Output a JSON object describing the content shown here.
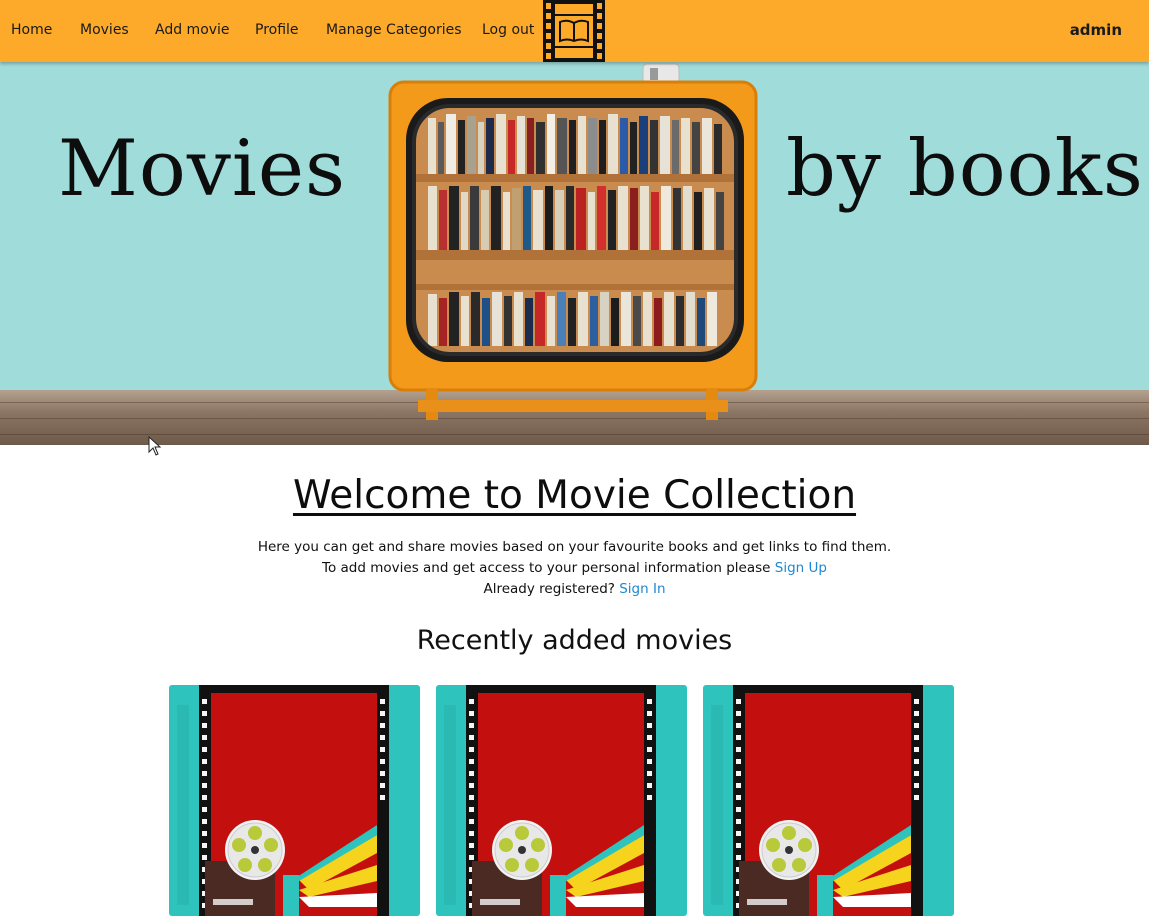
{
  "nav": {
    "items": [
      {
        "label": "Home"
      },
      {
        "label": "Movies"
      },
      {
        "label": "Add movie"
      },
      {
        "label": "Profile"
      },
      {
        "label": "Manage Categories"
      },
      {
        "label": "Log out"
      }
    ],
    "user": "admin"
  },
  "hero": {
    "left_text": "Movies",
    "right_text": "by books"
  },
  "content": {
    "title": "Welcome to Movie Collection",
    "line1": "Here you can get and share movies based on your favourite books and get links to find them.",
    "line2_prefix": "To add movies and get access to your personal information please ",
    "signup_link": "Sign Up",
    "line3_prefix": "Already registered? ",
    "signin_link": "Sign In",
    "recent_heading": "Recently added movies"
  },
  "colors": {
    "navbar": "#fdaa2a",
    "hero_bg": "#a0dcda",
    "link": "#1e88d2",
    "card_red": "#c40f0f",
    "card_teal": "#2ec4bd"
  }
}
